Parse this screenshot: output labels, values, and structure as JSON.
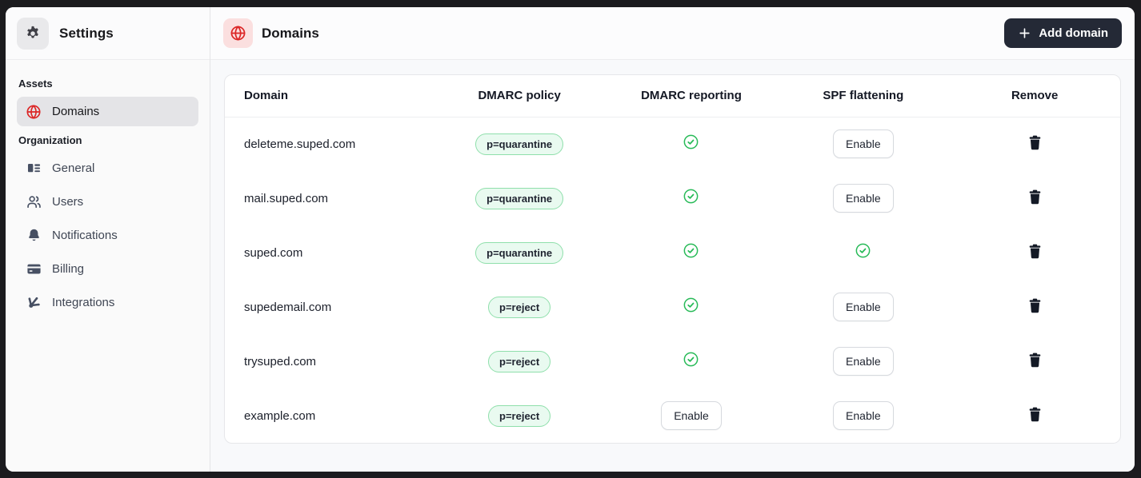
{
  "sidebar": {
    "title": "Settings",
    "sections": [
      {
        "label": "Assets",
        "items": [
          {
            "label": "Domains",
            "icon": "globe-icon",
            "active": true
          }
        ]
      },
      {
        "label": "Organization",
        "items": [
          {
            "label": "General",
            "icon": "general-icon",
            "active": false
          },
          {
            "label": "Users",
            "icon": "users-icon",
            "active": false
          },
          {
            "label": "Notifications",
            "icon": "bell-icon",
            "active": false
          },
          {
            "label": "Billing",
            "icon": "billing-icon",
            "active": false
          },
          {
            "label": "Integrations",
            "icon": "integrations-icon",
            "active": false
          }
        ]
      }
    ]
  },
  "header": {
    "title": "Domains",
    "icon": "globe-icon",
    "add_button": {
      "label": "Add domain",
      "icon": "plus-icon"
    }
  },
  "table": {
    "columns": [
      "Domain",
      "DMARC policy",
      "DMARC reporting",
      "SPF flattening",
      "Remove"
    ],
    "enable_label": "Enable",
    "rows": [
      {
        "domain": "deleteme.suped.com",
        "dmarc_policy": "p=quarantine",
        "dmarc_reporting": "enabled",
        "spf_flattening": "disabled"
      },
      {
        "domain": "mail.suped.com",
        "dmarc_policy": "p=quarantine",
        "dmarc_reporting": "enabled",
        "spf_flattening": "disabled"
      },
      {
        "domain": "suped.com",
        "dmarc_policy": "p=quarantine",
        "dmarc_reporting": "enabled",
        "spf_flattening": "enabled"
      },
      {
        "domain": "supedemail.com",
        "dmarc_policy": "p=reject",
        "dmarc_reporting": "enabled",
        "spf_flattening": "disabled"
      },
      {
        "domain": "trysuped.com",
        "dmarc_policy": "p=reject",
        "dmarc_reporting": "enabled",
        "spf_flattening": "disabled"
      },
      {
        "domain": "example.com",
        "dmarc_policy": "p=reject",
        "dmarc_reporting": "disabled",
        "spf_flattening": "disabled"
      }
    ]
  },
  "colors": {
    "accent_red": "#dc2626",
    "success_green": "#27ba57",
    "badge_bg": "#e9faf0",
    "badge_border": "#8fdfab",
    "dark_button": "#242936",
    "icon_gray": "#475063"
  }
}
